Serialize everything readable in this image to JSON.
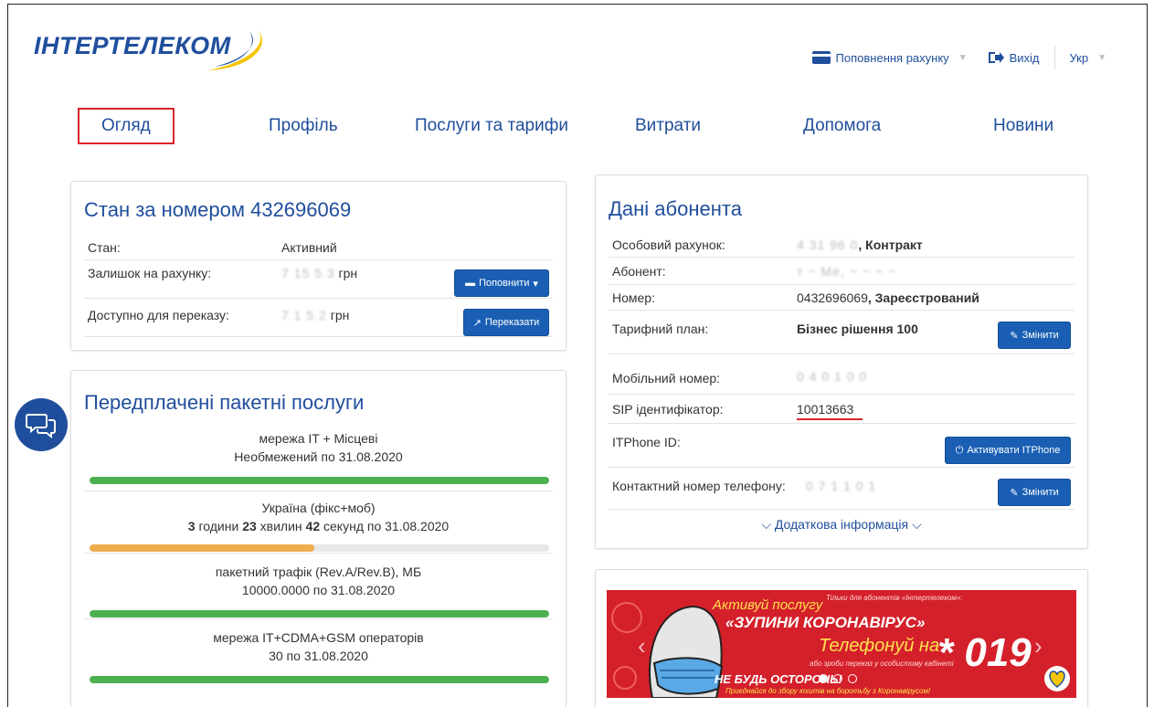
{
  "brand": {
    "logo_text": "ІНТЕРТЕЛЕКОМ"
  },
  "header": {
    "topup_label": "Поповнення рахунку",
    "logout_label": "Вихід",
    "language_label": "Укр"
  },
  "nav": {
    "items": [
      {
        "label": "Огляд",
        "active": true
      },
      {
        "label": "Профіль",
        "active": false
      },
      {
        "label": "Послуги та тарифи",
        "active": false
      },
      {
        "label": "Витрати",
        "active": false
      },
      {
        "label": "Допомога",
        "active": false
      },
      {
        "label": "Новини",
        "active": false
      }
    ]
  },
  "status": {
    "title": "Стан за номером 432696069",
    "rows": [
      {
        "label": "Стан:",
        "value": "Активний"
      },
      {
        "label": "Залишок на рахунку:",
        "value": "7 15 5.3",
        "unit": "грн"
      },
      {
        "label": "Доступно для переказу:",
        "value": "7 1 5.2",
        "unit": "грн"
      }
    ],
    "topup_button": "Поповнити",
    "transfer_button": "Переказати"
  },
  "packages": {
    "title": "Передплачені пакетні послуги",
    "items": [
      {
        "line1": "мережа IT + Місцеві",
        "line2": "Необмежений по 31.08.2020",
        "fill": 1.0,
        "color": "#4caf50"
      },
      {
        "line1": "Україна (фікс+моб)",
        "hours": "3",
        "hours_label": "години",
        "minutes": "23",
        "minutes_label": "хвилин",
        "seconds": "42",
        "seconds_label": "секунд по 31.08.2020",
        "fill": 0.49,
        "color": "#f0ad4e"
      },
      {
        "line1": "пакетний трафік (Rev.A/Rev.B), МБ",
        "line2": "10000.0000 по 31.08.2020",
        "fill": 1.0,
        "color": "#4caf50"
      },
      {
        "line1": "мережа IT+CDMA+GSM операторів",
        "line2": "30 по 31.08.2020",
        "fill": 1.0,
        "color": "#4caf50"
      }
    ]
  },
  "subscriber": {
    "title": "Дані абонента",
    "account_label": "Особовий рахунок:",
    "account_value": "4 31 96 0",
    "account_type": ", Контракт",
    "subscriber_label": "Абонент:",
    "subscriber_value": "т ~ Ме, ~ ~ ~ ~",
    "number_label": "Номер:",
    "number_value": "0432696069",
    "number_status": ", Зареєстрований",
    "tariff_label": "Тарифний план:",
    "tariff_value": "Бізнес рішення 100",
    "change_button": "Змінити",
    "mobile_label": "Мобільний номер:",
    "mobile_value": "0 4 0 1 0 0",
    "sip_label": "SIP ідентифікатор:",
    "sip_value": "10013663",
    "itphone_label": "ITPhone ID:",
    "activate_button": "Активувати ITPhone",
    "contact_label": "Контактний номер телефону:",
    "contact_value": "0 7 1 1 0 1",
    "change_button_2": "Змінити",
    "more_info": "Додаткова інформація"
  },
  "banner": {
    "line1": "Активуй послугу",
    "line2": "«ЗУПИНИ КОРОНАВІРУС»",
    "line3": "Телефонуй на",
    "code": "* 019",
    "line4": "НЕ БУДЬ ОСТОРОНЬ!",
    "line5": "Приєднайся до збору коштів на боротьбу з Коронавірусом!",
    "top_note": "Тільки для абонентів «Інтертелеком»:",
    "sub_note": "або зроби переказ у особистому кабінеті"
  },
  "colors": {
    "brand_blue": "#1f4e9c",
    "button_blue": "#1a5fb4",
    "active_red": "#d9262b",
    "bar_green": "#4caf50",
    "bar_orange": "#f0ad4e",
    "banner_red": "#d4202a"
  }
}
